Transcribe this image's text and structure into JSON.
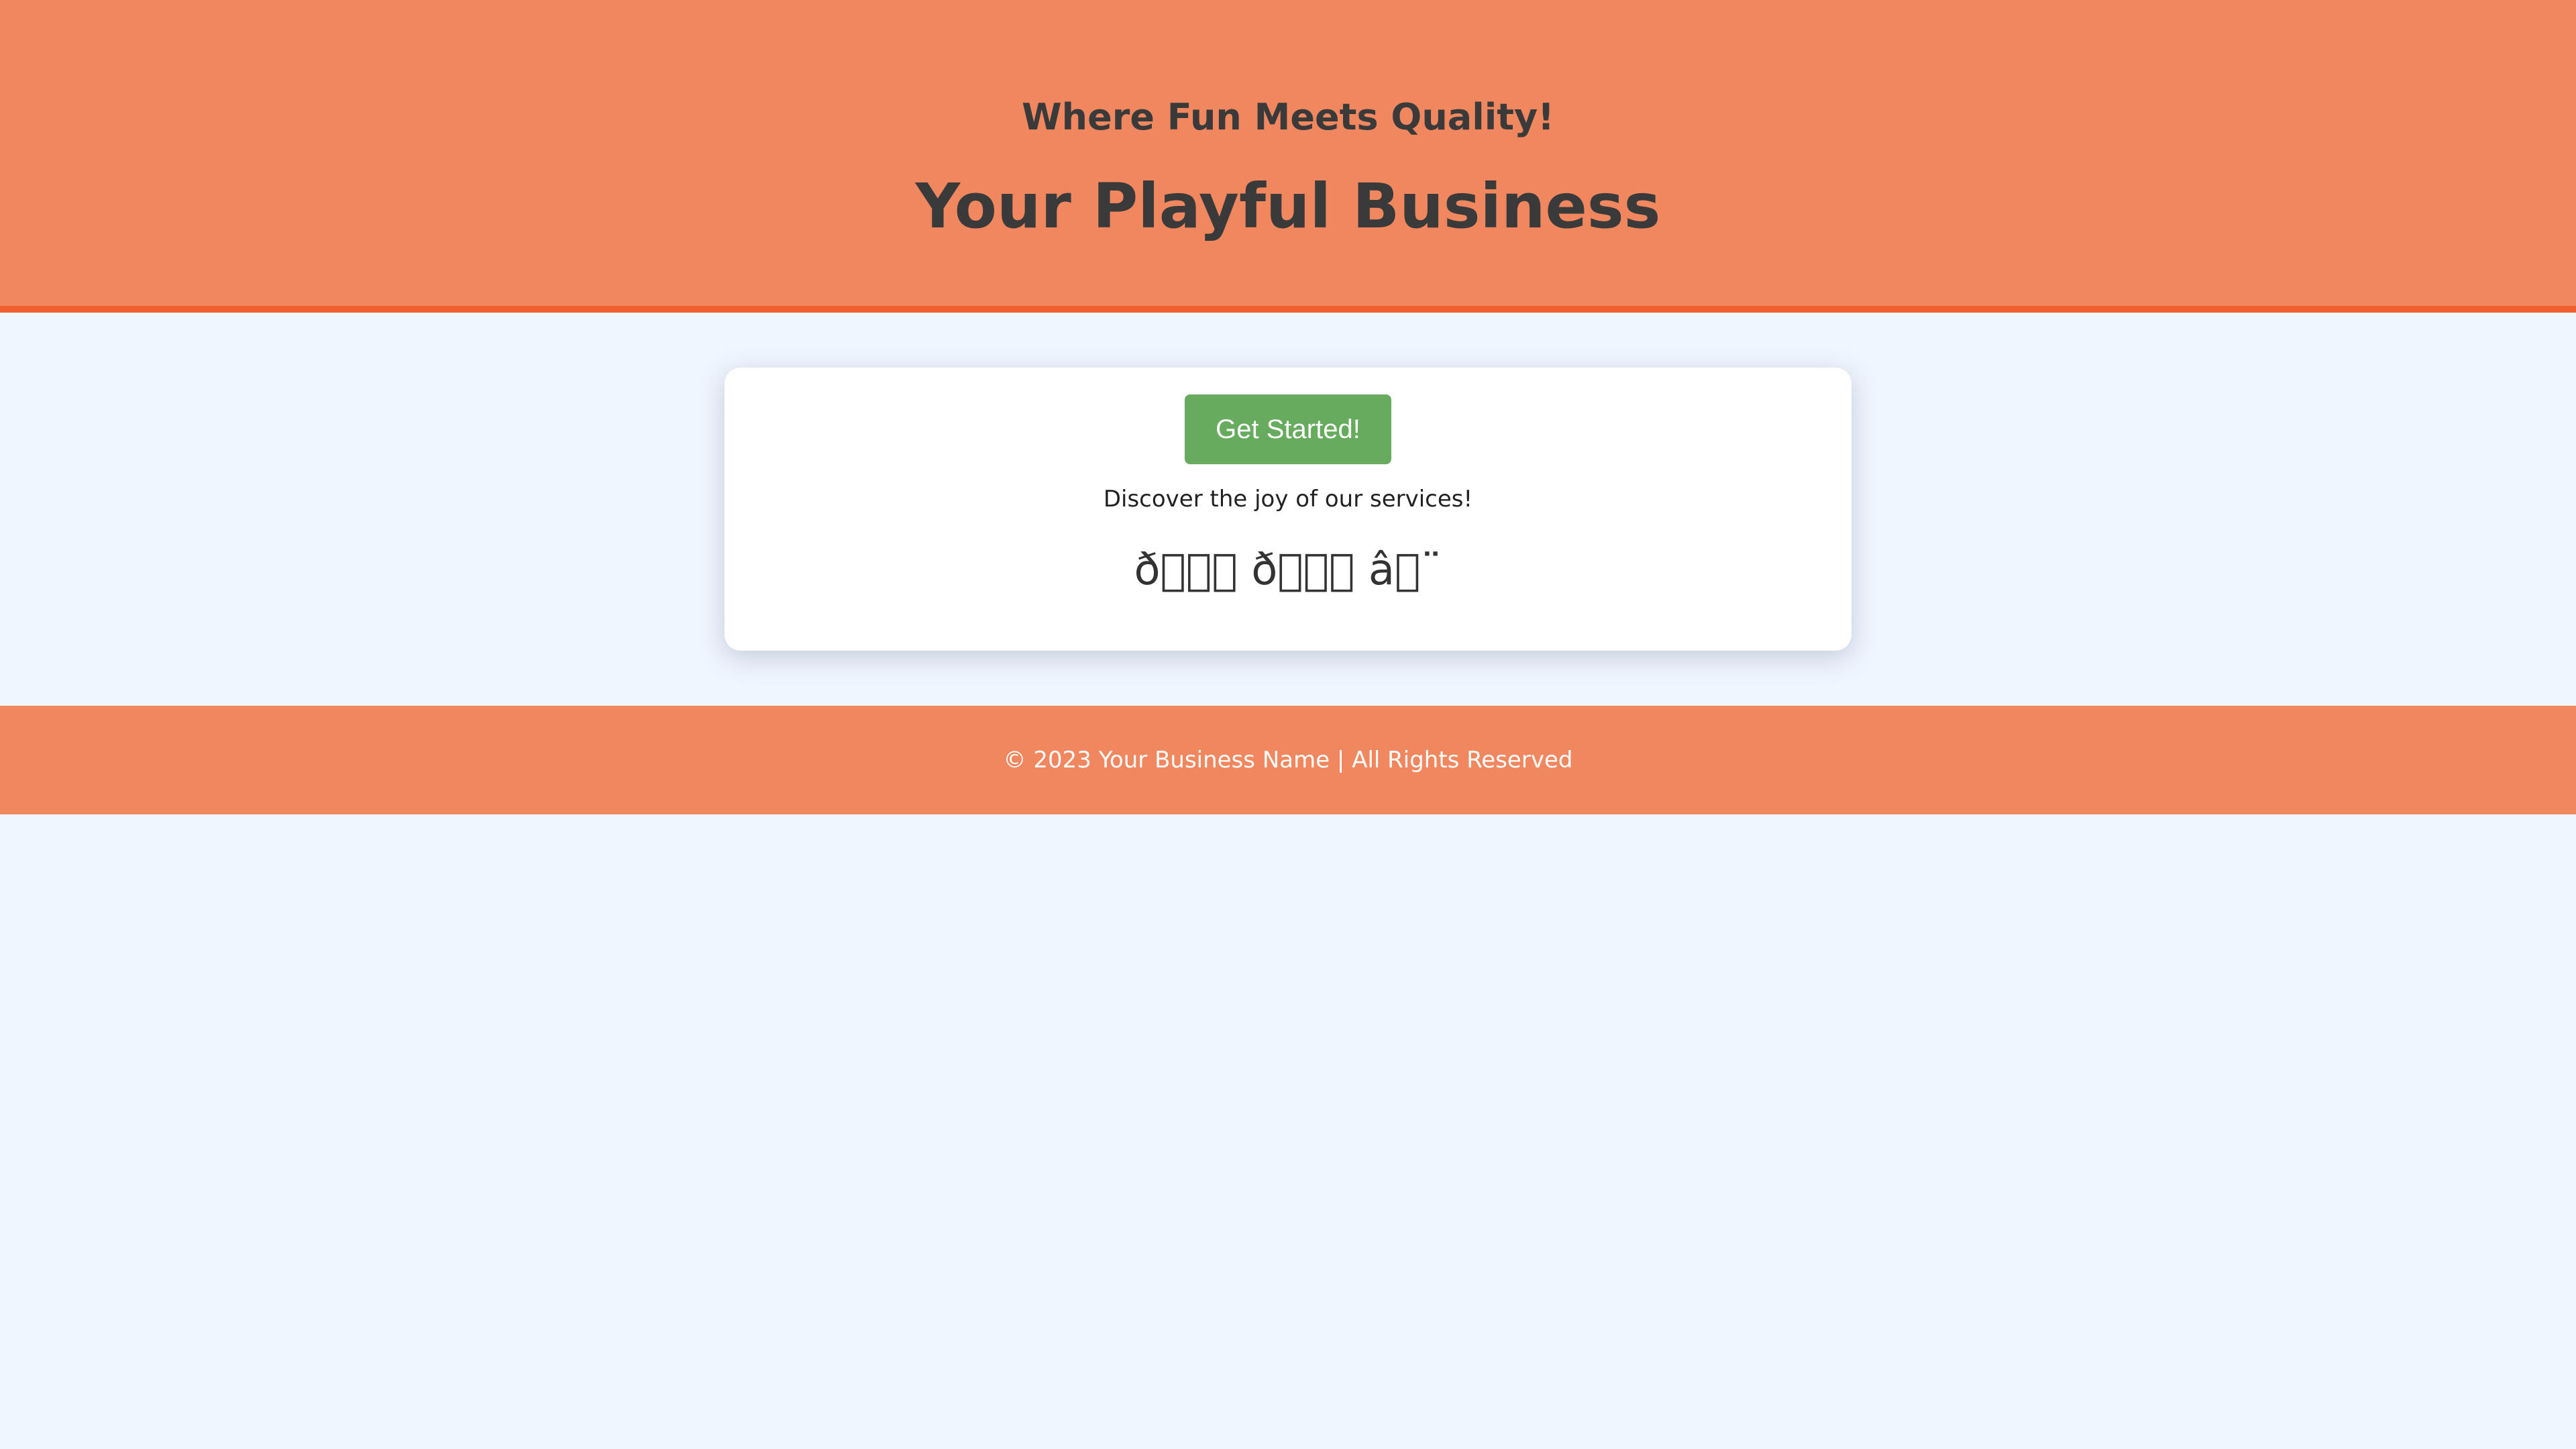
{
  "header": {
    "tagline": "Where Fun Meets Quality!",
    "title": "Your Playful Business"
  },
  "main": {
    "cta_label": "Get Started!",
    "description": "Discover the joy of our services!",
    "emoji_line": "ð\u0000\u0000\u0000 ð\u0000\u0000\u0000 â\u0000¨"
  },
  "footer": {
    "text": "© 2023 Your Business Name | All Rights Reserved"
  },
  "colors": {
    "header_bg": "#f0875f",
    "header_border": "#f0602c",
    "page_bg": "#f0f6ff",
    "cta_bg": "#66ab5e",
    "footer_bg": "#f0875f"
  }
}
